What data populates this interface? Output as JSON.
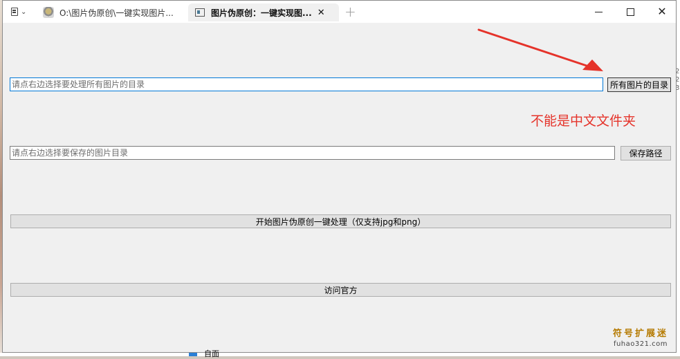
{
  "browser": {
    "tabs": [
      {
        "label": "O:\\图片伪原创\\一键实现图片..."
      },
      {
        "label": "图片伪原创：一键实现图..."
      }
    ],
    "new_tab": "+",
    "close_tab": "✕",
    "win_close": "✕"
  },
  "app": {
    "source_dir": {
      "placeholder": "请点右边选择要处理所有图片的目录",
      "value": "",
      "button_label": "所有图片的目录"
    },
    "note": "不能是中文文件夹",
    "save_dir": {
      "placeholder": "请点右边选择要保存的图片目录",
      "value": "",
      "button_label": "保存路径"
    },
    "process_button_label": "开始图片伪原创一键处理（仅支持jpg和png）",
    "visit_button_label": "访问官方"
  },
  "watermark": {
    "title": "符号扩展迷",
    "url": "fuhao321.com"
  },
  "behind": {
    "item_label": "自面",
    "side_digits": [
      "2",
      "2",
      "3"
    ]
  },
  "colors": {
    "note": "#e5332a",
    "arrow": "#e5332a",
    "focus": "#0078d7"
  }
}
